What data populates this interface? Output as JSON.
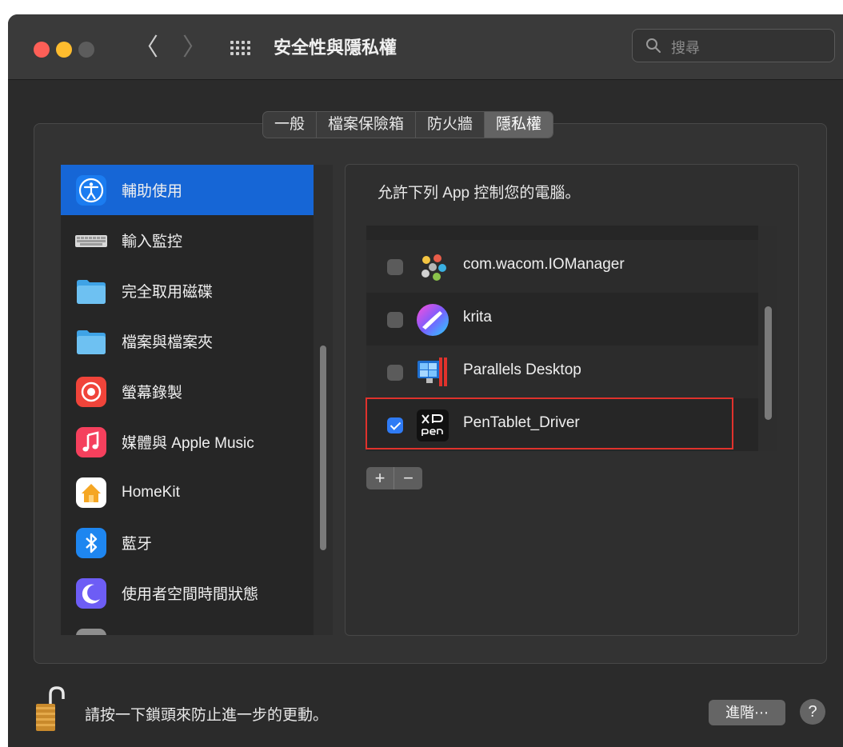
{
  "window": {
    "title": "安全性與隱私權",
    "search_placeholder": "搜尋",
    "back_glyph": "〈",
    "forward_glyph": "〉"
  },
  "tabs": [
    {
      "label": "一般",
      "active": false
    },
    {
      "label": "檔案保險箱",
      "active": false
    },
    {
      "label": "防火牆",
      "active": false
    },
    {
      "label": "隱私權",
      "active": true
    }
  ],
  "sidebar": {
    "items": [
      {
        "label": "輔助使用",
        "icon": "accessibility-icon",
        "selected": true
      },
      {
        "label": "輸入監控",
        "icon": "keyboard-icon",
        "selected": false
      },
      {
        "label": "完全取用磁碟",
        "icon": "folder-icon",
        "selected": false
      },
      {
        "label": "檔案與檔案夾",
        "icon": "folder-icon",
        "selected": false
      },
      {
        "label": "螢幕錄製",
        "icon": "screen-record-icon",
        "selected": false
      },
      {
        "label": "媒體與 Apple Music",
        "icon": "music-icon",
        "selected": false
      },
      {
        "label": "HomeKit",
        "icon": "home-icon",
        "selected": false
      },
      {
        "label": "藍牙",
        "icon": "bluetooth-icon",
        "selected": false
      },
      {
        "label": "使用者空間時間狀態",
        "icon": "moon-icon",
        "selected": false
      }
    ]
  },
  "privacy": {
    "description": "允許下列 App 控制您的電腦。",
    "apps": [
      {
        "name": "com.wacom.IOManager",
        "checked": false,
        "icon": "wacom-icon"
      },
      {
        "name": "krita",
        "checked": false,
        "icon": "krita-icon"
      },
      {
        "name": "Parallels Desktop",
        "checked": false,
        "icon": "parallels-icon"
      },
      {
        "name": "PenTablet_Driver",
        "checked": true,
        "icon": "xppen-icon"
      }
    ],
    "add_label": "+",
    "remove_label": "−"
  },
  "footer": {
    "lock_text": "請按一下鎖頭來防止進一步的更動。",
    "advanced_label": "進階⋯",
    "help_label": "?"
  },
  "colors": {
    "accent": "#1666d6",
    "checkbox_on": "#2f7bf5",
    "highlight_border": "#e0322c"
  }
}
